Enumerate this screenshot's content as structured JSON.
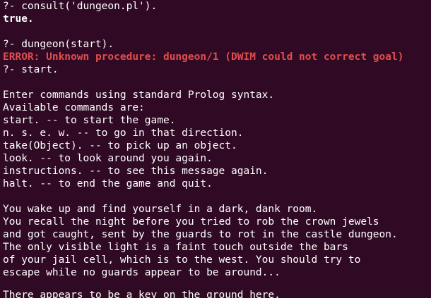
{
  "terminal": {
    "lines": [
      {
        "text": "?- consult('dungeon.pl').",
        "style": "normal"
      },
      {
        "text": "true.",
        "style": "bold"
      },
      {
        "text": "",
        "style": "blank"
      },
      {
        "text": "?- dungeon(start).",
        "style": "normal"
      },
      {
        "text": "ERROR: Unknown procedure: dungeon/1 (DWIM could not correct goal)",
        "style": "error"
      },
      {
        "text": "?- start.",
        "style": "normal"
      },
      {
        "text": "",
        "style": "blank"
      },
      {
        "text": "Enter commands using standard Prolog syntax.",
        "style": "normal"
      },
      {
        "text": "Available commands are:",
        "style": "normal"
      },
      {
        "text": "start. -- to start the game.",
        "style": "normal"
      },
      {
        "text": "n. s. e. w. -- to go in that direction.",
        "style": "normal"
      },
      {
        "text": "take(Object). -- to pick up an object.",
        "style": "normal"
      },
      {
        "text": "look. -- to look around you again.",
        "style": "normal"
      },
      {
        "text": "instructions. -- to see this message again.",
        "style": "normal"
      },
      {
        "text": "halt. -- to end the game and quit.",
        "style": "normal"
      },
      {
        "text": "",
        "style": "blank"
      },
      {
        "text": "You wake up and find yourself in a dark, dank room.",
        "style": "normal"
      },
      {
        "text": "You recall the night before you tried to rob the crown jewels",
        "style": "normal"
      },
      {
        "text": "and got caught, sent by the guards to rot in the castle dungeon.",
        "style": "normal"
      },
      {
        "text": "The only visible light is a faint touch outside the bars",
        "style": "normal"
      },
      {
        "text": "of your jail cell, which is to the west. You should try to",
        "style": "normal"
      },
      {
        "text": "escape while no guards appear to be around...",
        "style": "normal"
      },
      {
        "text": "",
        "style": "blank"
      }
    ],
    "clipped_line": "There appears to be a key on the ground here."
  }
}
